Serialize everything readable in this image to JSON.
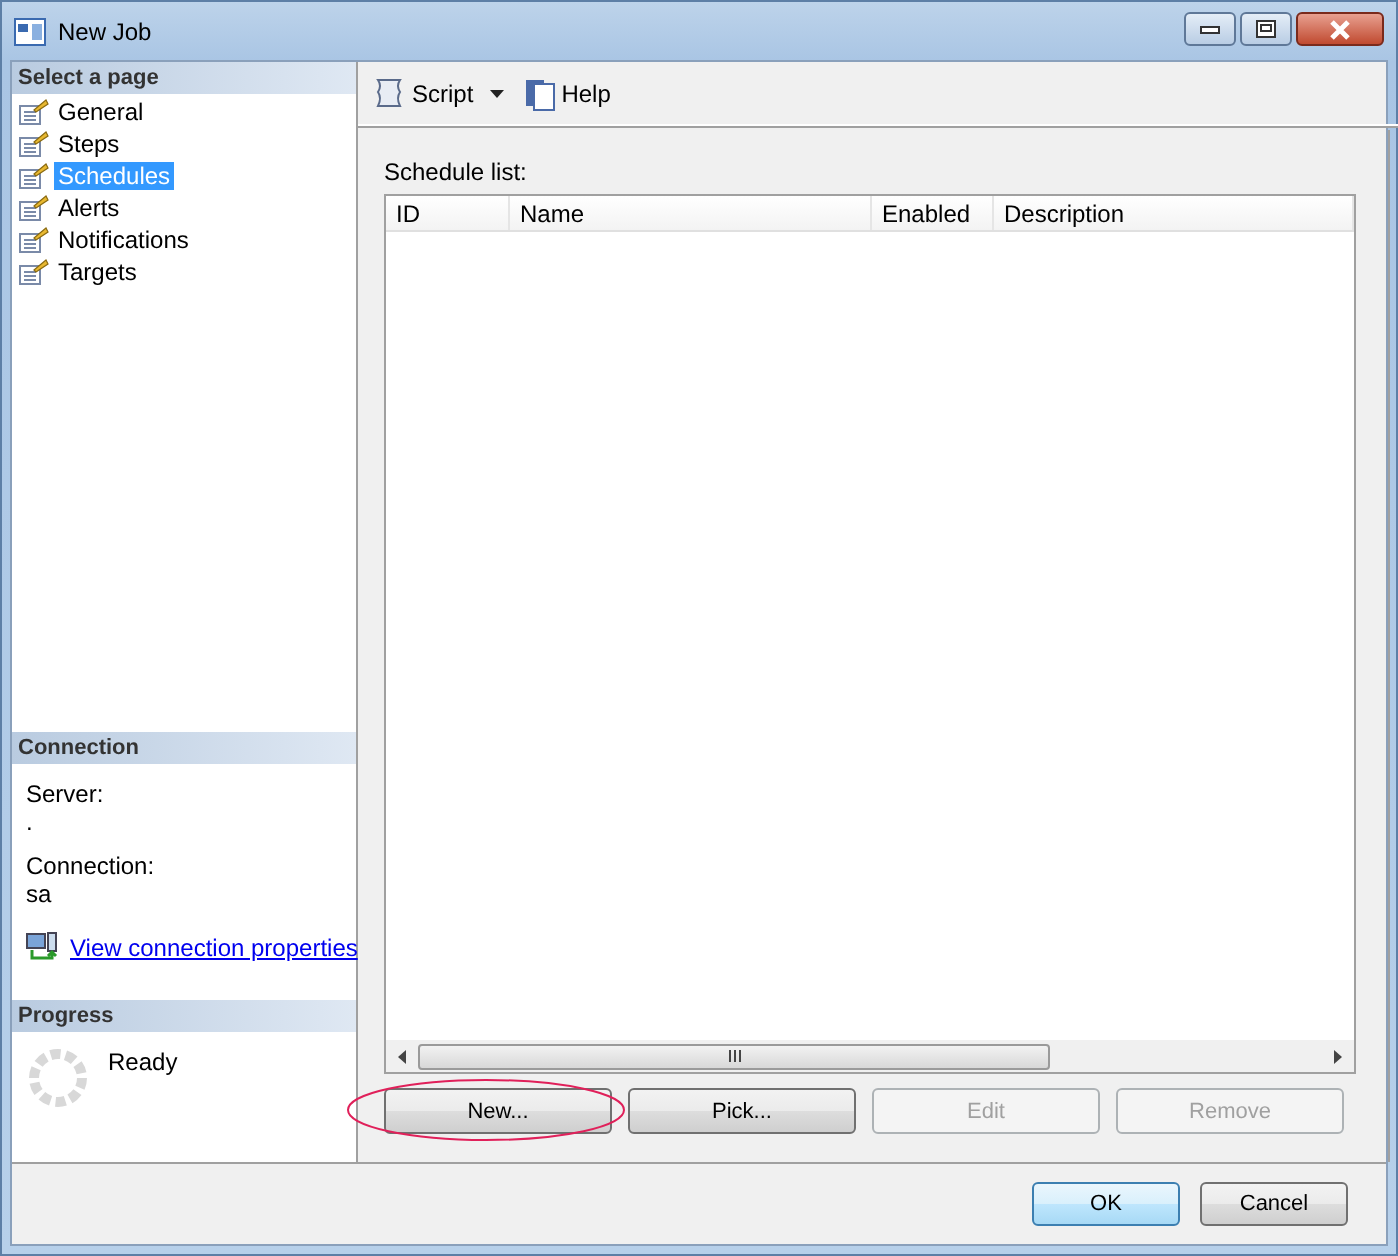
{
  "window": {
    "title": "New Job"
  },
  "sidebar": {
    "header": "Select a page",
    "items": [
      {
        "label": "General",
        "selected": false
      },
      {
        "label": "Steps",
        "selected": false
      },
      {
        "label": "Schedules",
        "selected": true
      },
      {
        "label": "Alerts",
        "selected": false
      },
      {
        "label": "Notifications",
        "selected": false
      },
      {
        "label": "Targets",
        "selected": false
      }
    ]
  },
  "connection": {
    "header": "Connection",
    "server_label": "Server:",
    "server_value": ".",
    "connection_label": "Connection:",
    "connection_value": "sa",
    "link": "View connection properties"
  },
  "progress": {
    "header": "Progress",
    "status": "Ready"
  },
  "toolbar": {
    "script": "Script",
    "help": "Help"
  },
  "schedule_list": {
    "label": "Schedule list:",
    "columns": [
      "ID",
      "Name",
      "Enabled",
      "Description"
    ],
    "buttons": [
      {
        "label": "New...",
        "disabled": false
      },
      {
        "label": "Pick...",
        "disabled": false
      },
      {
        "label": "Edit",
        "disabled": true
      },
      {
        "label": "Remove",
        "disabled": true
      }
    ]
  },
  "footer_buttons": [
    {
      "label": "OK",
      "default": true
    },
    {
      "label": "Cancel",
      "default": false
    }
  ]
}
